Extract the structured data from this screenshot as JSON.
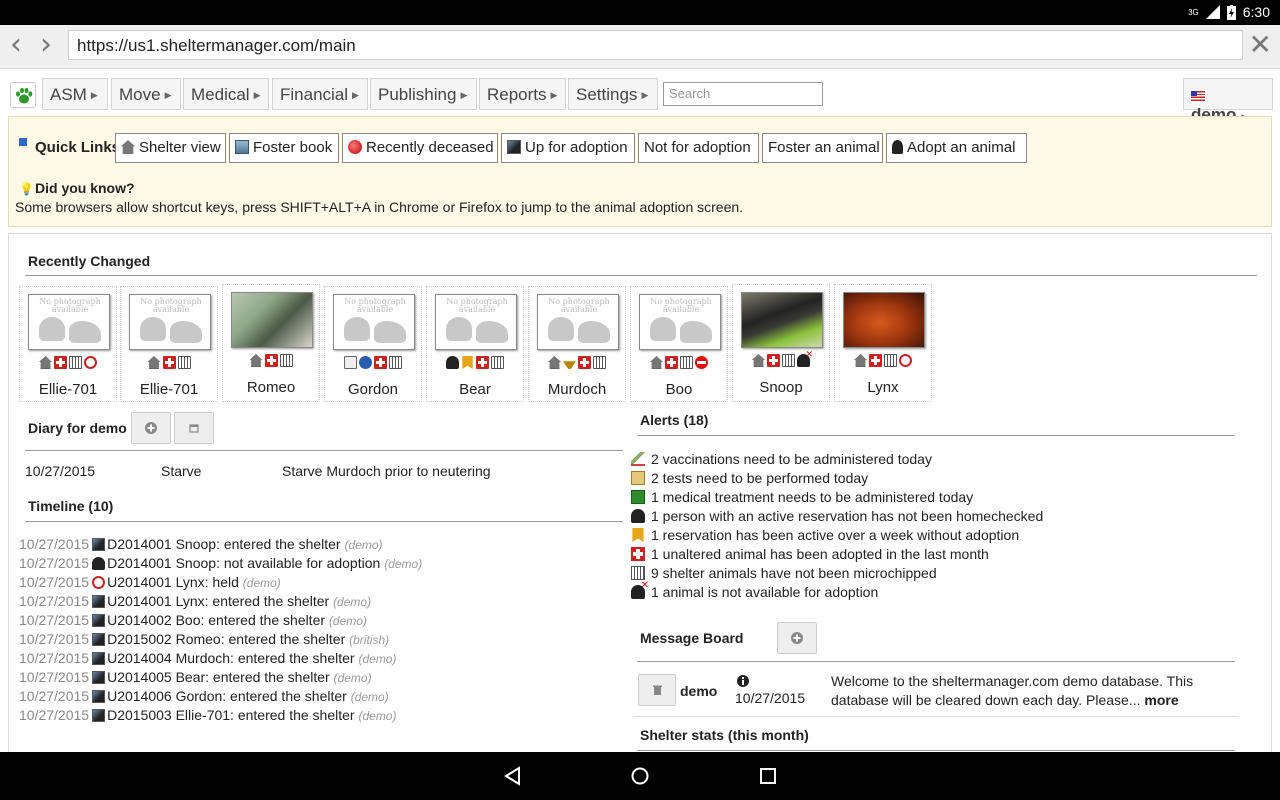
{
  "status_bar": {
    "network": "3G",
    "time": "6:30"
  },
  "browser": {
    "url": "https://us1.sheltermanager.com/main"
  },
  "menubar": {
    "items": [
      "ASM",
      "Move",
      "Medical",
      "Financial",
      "Publishing",
      "Reports",
      "Settings"
    ],
    "search_placeholder": "Search",
    "user": "demo"
  },
  "quick_links": {
    "title": "Quick Links",
    "links": [
      "Shelter view",
      "Foster book",
      "Recently deceased",
      "Up for adoption",
      "Not for adoption",
      "Foster an animal",
      "Adopt an animal"
    ]
  },
  "did_you_know": {
    "title": "Did you know?",
    "text": "Some browsers allow shortcut keys, press SHIFT+ALT+A in Chrome or Firefox to jump to the animal adoption screen."
  },
  "recently_changed": {
    "title": "Recently Changed",
    "no_photo_text": "No photograph available",
    "animals": [
      {
        "name": "Ellie-701",
        "photo": "none",
        "flags": [
          "house",
          "redcross",
          "chip",
          "clock"
        ]
      },
      {
        "name": "Ellie-701",
        "photo": "none",
        "flags": [
          "house",
          "redcross",
          "chip"
        ]
      },
      {
        "name": "Romeo",
        "photo": "romeo",
        "flags": [
          "house",
          "redcross",
          "chip"
        ]
      },
      {
        "name": "Gordon",
        "photo": "none",
        "flags": [
          "card",
          "info",
          "redcross",
          "chip"
        ]
      },
      {
        "name": "Bear",
        "photo": "none",
        "flags": [
          "person",
          "ribbon",
          "redcross",
          "chip"
        ]
      },
      {
        "name": "Murdoch",
        "photo": "none",
        "flags": [
          "house",
          "scale",
          "redcross",
          "chip"
        ]
      },
      {
        "name": "Boo",
        "photo": "none",
        "flags": [
          "house",
          "redcross",
          "chip",
          "nope"
        ]
      },
      {
        "name": "Snoop",
        "photo": "snoop",
        "flags": [
          "house",
          "redcross",
          "chip",
          "noadopt"
        ]
      },
      {
        "name": "Lynx",
        "photo": "lynx",
        "flags": [
          "house",
          "redcross",
          "chip",
          "clock"
        ]
      }
    ]
  },
  "diary": {
    "title": "Diary for demo",
    "entries": [
      {
        "date": "10/27/2015",
        "subject": "Starve",
        "note": "Starve Murdoch prior to neutering"
      }
    ]
  },
  "timeline": {
    "title": "Timeline (10)",
    "rows": [
      {
        "date": "10/27/2015",
        "icon": "entered",
        "text": "D2014001 Snoop: entered the shelter",
        "user": "(demo)"
      },
      {
        "date": "10/27/2015",
        "icon": "noadopt",
        "text": "D2014001 Snoop: not available for adoption",
        "user": "(demo)"
      },
      {
        "date": "10/27/2015",
        "icon": "held",
        "text": "U2014001 Lynx: held",
        "user": "(demo)"
      },
      {
        "date": "10/27/2015",
        "icon": "entered",
        "text": "U2014001 Lynx: entered the shelter",
        "user": "(demo)"
      },
      {
        "date": "10/27/2015",
        "icon": "entered",
        "text": "U2014002 Boo: entered the shelter",
        "user": "(demo)"
      },
      {
        "date": "10/27/2015",
        "icon": "entered",
        "text": "D2015002 Romeo: entered the shelter",
        "user": "(british)"
      },
      {
        "date": "10/27/2015",
        "icon": "entered",
        "text": "U2014004 Murdoch: entered the shelter",
        "user": "(demo)"
      },
      {
        "date": "10/27/2015",
        "icon": "entered",
        "text": "U2014005 Bear: entered the shelter",
        "user": "(demo)"
      },
      {
        "date": "10/27/2015",
        "icon": "entered",
        "text": "U2014006 Gordon: entered the shelter",
        "user": "(demo)"
      },
      {
        "date": "10/27/2015",
        "icon": "entered",
        "text": "D2015003 Ellie-701: entered the shelter",
        "user": "(demo)"
      }
    ]
  },
  "alerts": {
    "title": "Alerts (18)",
    "rows": [
      {
        "icon": "needle",
        "text": "2 vaccinations need to be administered today"
      },
      {
        "icon": "clip",
        "text": "2 tests need to be performed today"
      },
      {
        "icon": "med",
        "text": "1 medical treatment needs to be administered today"
      },
      {
        "icon": "person",
        "text": "1 person with an active reservation has not been homechecked"
      },
      {
        "icon": "ribbon",
        "text": "1 reservation has been active over a week without adoption"
      },
      {
        "icon": "redcross",
        "text": "1 unaltered animal has been adopted in the last month"
      },
      {
        "icon": "chip",
        "text": "9 shelter animals have not been microchipped"
      },
      {
        "icon": "noadopt",
        "text": "1 animal is not available for adoption"
      }
    ]
  },
  "message_board": {
    "title": "Message Board",
    "messages": [
      {
        "user": "demo",
        "date": "10/27/2015",
        "text": "Welcome to the sheltermanager.com demo database. This database will be cleared down each day. Please...",
        "more": "more"
      }
    ]
  },
  "shelter_stats": {
    "title": "Shelter stats (this month)"
  }
}
